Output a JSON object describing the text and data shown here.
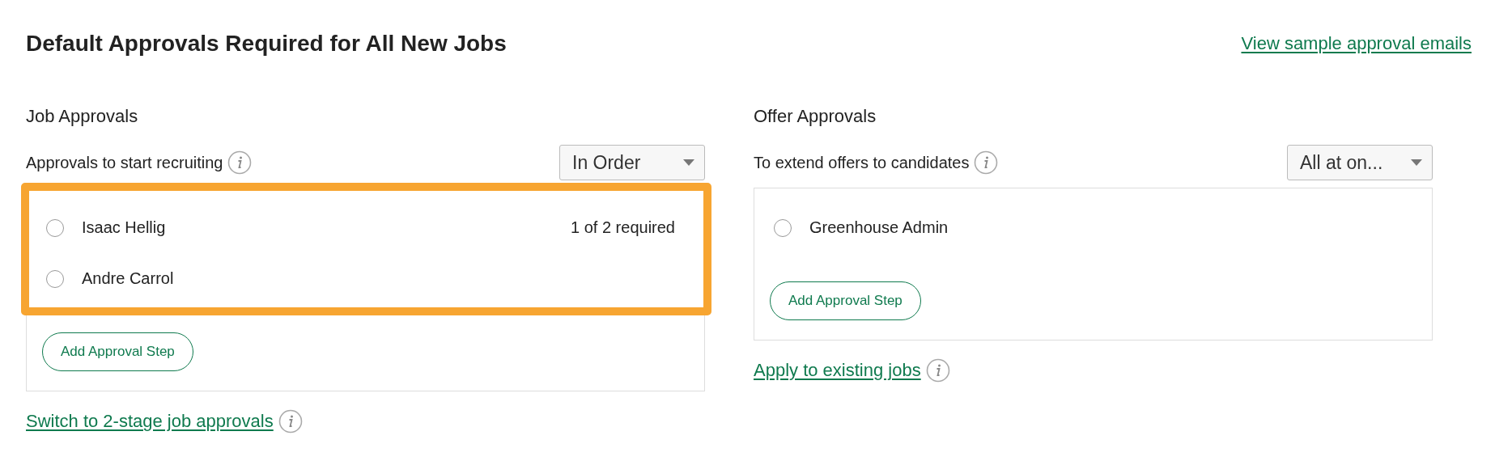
{
  "title": "Default Approvals Required for All New Jobs",
  "sample_link": "View sample approval emails",
  "sections": [
    {
      "heading": "Job Approvals",
      "subtitle": "Approvals to start recruiting",
      "mode": "In Order",
      "highlighted": true,
      "approvers": [
        {
          "name": "Isaac Hellig",
          "note": "1 of 2 required",
          "selected": false
        },
        {
          "name": "Andre Carrol",
          "selected": false
        }
      ],
      "add_button": "Add Approval Step",
      "footer_link": "Switch to 2-stage job approvals"
    },
    {
      "heading": "Offer Approvals",
      "subtitle": "To extend offers to candidates",
      "mode": "All at on...",
      "highlighted": false,
      "approvers": [
        {
          "name": "Greenhouse Admin",
          "selected": false
        }
      ],
      "add_button": "Add Approval Step",
      "footer_link": "Apply to existing jobs"
    }
  ]
}
